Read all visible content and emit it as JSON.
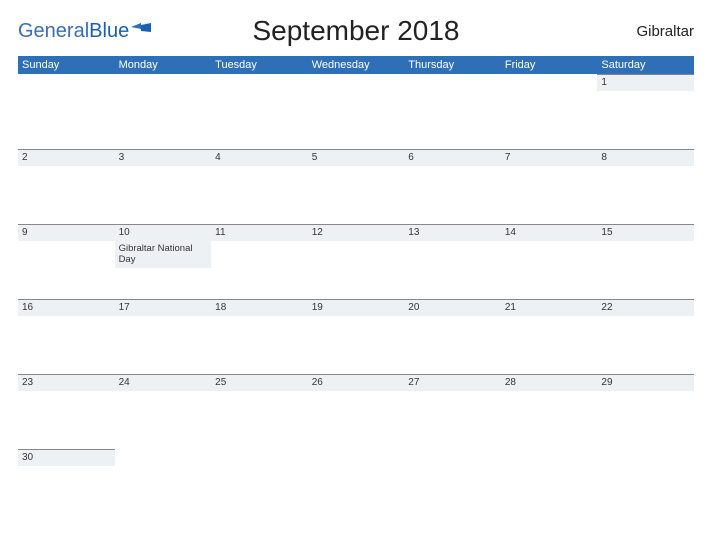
{
  "logo": {
    "part1": "General",
    "part2": "Blue"
  },
  "title": "September 2018",
  "region": "Gibraltar",
  "day_names": [
    "Sunday",
    "Monday",
    "Tuesday",
    "Wednesday",
    "Thursday",
    "Friday",
    "Saturday"
  ],
  "weeks": [
    [
      {
        "n": "",
        "empty": true
      },
      {
        "n": "",
        "empty": true
      },
      {
        "n": "",
        "empty": true
      },
      {
        "n": "",
        "empty": true
      },
      {
        "n": "",
        "empty": true
      },
      {
        "n": "",
        "empty": true
      },
      {
        "n": "1"
      }
    ],
    [
      {
        "n": "2"
      },
      {
        "n": "3"
      },
      {
        "n": "4"
      },
      {
        "n": "5"
      },
      {
        "n": "6"
      },
      {
        "n": "7"
      },
      {
        "n": "8"
      }
    ],
    [
      {
        "n": "9"
      },
      {
        "n": "10",
        "event": "Gibraltar National Day"
      },
      {
        "n": "11"
      },
      {
        "n": "12"
      },
      {
        "n": "13"
      },
      {
        "n": "14"
      },
      {
        "n": "15"
      }
    ],
    [
      {
        "n": "16"
      },
      {
        "n": "17"
      },
      {
        "n": "18"
      },
      {
        "n": "19"
      },
      {
        "n": "20"
      },
      {
        "n": "21"
      },
      {
        "n": "22"
      }
    ],
    [
      {
        "n": "23"
      },
      {
        "n": "24"
      },
      {
        "n": "25"
      },
      {
        "n": "26"
      },
      {
        "n": "27"
      },
      {
        "n": "28"
      },
      {
        "n": "29"
      }
    ],
    [
      {
        "n": "30"
      },
      {
        "n": "",
        "empty": true
      },
      {
        "n": "",
        "empty": true
      },
      {
        "n": "",
        "empty": true
      },
      {
        "n": "",
        "empty": true
      },
      {
        "n": "",
        "empty": true
      },
      {
        "n": "",
        "empty": true
      }
    ]
  ],
  "colors": {
    "accent": "#2f6fb7",
    "strip": "#eef1f4"
  }
}
